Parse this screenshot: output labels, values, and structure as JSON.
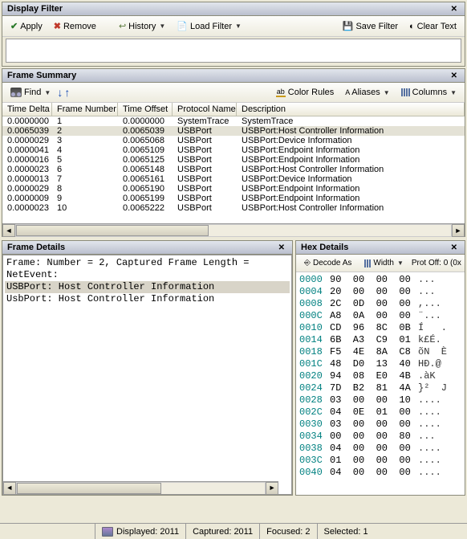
{
  "display_filter": {
    "title": "Display Filter",
    "apply": "Apply",
    "remove": "Remove",
    "history": "History",
    "load_filter": "Load Filter",
    "save_filter": "Save Filter",
    "clear_text": "Clear Text"
  },
  "frame_summary": {
    "title": "Frame Summary",
    "find": "Find",
    "color_rules": "Color Rules",
    "aliases": "Aliases",
    "columns": "Columns",
    "headers": {
      "time_delta": "Time Delta",
      "frame_number": "Frame Number",
      "time_offset": "Time Offset",
      "protocol_name": "Protocol Name",
      "description": "Description"
    },
    "rows": [
      {
        "td": "0.0000000",
        "fn": "1",
        "to": "0.0000000",
        "pn": "SystemTrace",
        "de": "SystemTrace"
      },
      {
        "td": "0.0065039",
        "fn": "2",
        "to": "0.0065039",
        "pn": "USBPort",
        "de": "USBPort:Host Controller Information"
      },
      {
        "td": "0.0000029",
        "fn": "3",
        "to": "0.0065068",
        "pn": "USBPort",
        "de": "USBPort:Device Information"
      },
      {
        "td": "0.0000041",
        "fn": "4",
        "to": "0.0065109",
        "pn": "USBPort",
        "de": "USBPort:Endpoint Information"
      },
      {
        "td": "0.0000016",
        "fn": "5",
        "to": "0.0065125",
        "pn": "USBPort",
        "de": "USBPort:Endpoint Information"
      },
      {
        "td": "0.0000023",
        "fn": "6",
        "to": "0.0065148",
        "pn": "USBPort",
        "de": "USBPort:Host Controller Information"
      },
      {
        "td": "0.0000013",
        "fn": "7",
        "to": "0.0065161",
        "pn": "USBPort",
        "de": "USBPort:Device Information"
      },
      {
        "td": "0.0000029",
        "fn": "8",
        "to": "0.0065190",
        "pn": "USBPort",
        "de": "USBPort:Endpoint Information"
      },
      {
        "td": "0.0000009",
        "fn": "9",
        "to": "0.0065199",
        "pn": "USBPort",
        "de": "USBPort:Endpoint Information"
      },
      {
        "td": "0.0000023",
        "fn": "10",
        "to": "0.0065222",
        "pn": "USBPort",
        "de": "USBPort:Host Controller Information"
      }
    ]
  },
  "frame_details": {
    "title": "Frame Details",
    "lines": [
      {
        "text": "Frame: Number = 2, Captured Frame Length =",
        "hl": false
      },
      {
        "text": "NetEvent:",
        "hl": false
      },
      {
        "text": "USBPort: Host Controller Information",
        "hl": true
      },
      {
        "text": "UsbPort: Host Controller Information",
        "hl": false
      }
    ]
  },
  "hex_details": {
    "title": "Hex Details",
    "decode_as": "Decode As",
    "width": "Width",
    "prot_off": "Prot Off: 0 (0x",
    "rows": [
      {
        "o": "0000",
        "b": "90  00  00  00",
        "a": "..."
      },
      {
        "o": "0004",
        "b": "20  00  00  00",
        "a": "..."
      },
      {
        "o": "0008",
        "b": "2C  0D  00  00",
        "a": ",..."
      },
      {
        "o": "000C",
        "b": "A8  0A  00  00",
        "a": "¨..."
      },
      {
        "o": "0010",
        "b": "CD  96  8C  0B",
        "a": "Í   ."
      },
      {
        "o": "0014",
        "b": "6B  A3  C9  01",
        "a": "k£É."
      },
      {
        "o": "0018",
        "b": "F5  4E  8A  C8",
        "a": "õN  È"
      },
      {
        "o": "001C",
        "b": "48  D0  13  40",
        "a": "HÐ.@"
      },
      {
        "o": "0020",
        "b": "94  08  E0  4B",
        "a": ".àK"
      },
      {
        "o": "0024",
        "b": "7D  B2  81  4A",
        "a": "}²  J"
      },
      {
        "o": "0028",
        "b": "03  00  00  10",
        "a": "...."
      },
      {
        "o": "002C",
        "b": "04  0E  01  00",
        "a": "...."
      },
      {
        "o": "0030",
        "b": "03  00  00  00",
        "a": "...."
      },
      {
        "o": "0034",
        "b": "00  00  00  80",
        "a": "..."
      },
      {
        "o": "0038",
        "b": "04  00  00  00",
        "a": "...."
      },
      {
        "o": "003C",
        "b": "01  00  00  00",
        "a": "...."
      },
      {
        "o": "0040",
        "b": "04  00  00  00",
        "a": "...."
      }
    ]
  },
  "status": {
    "displayed": "Displayed: 2011",
    "captured": "Captured: 2011",
    "focused": "Focused: 2",
    "selected": "Selected: 1"
  }
}
